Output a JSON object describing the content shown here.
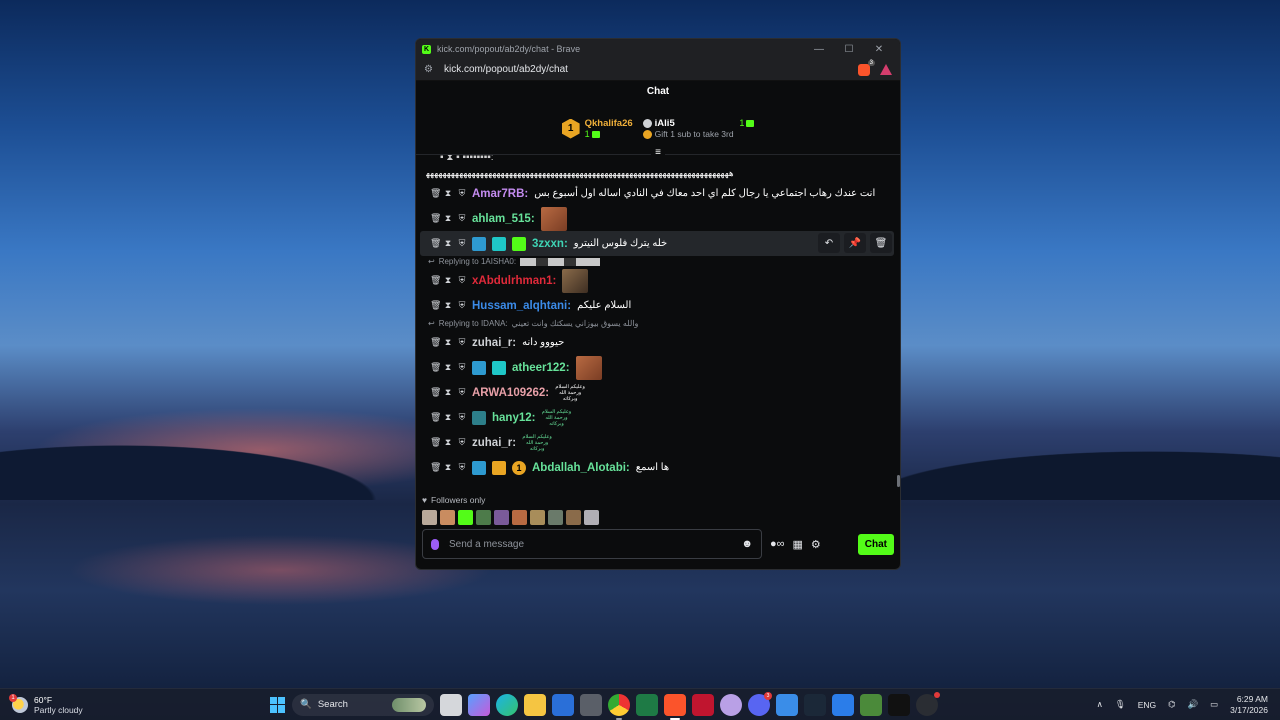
{
  "browser": {
    "title": "kick.com/popout/ab2dy/chat - Brave",
    "url": "kick.com/popout/ab2dy/chat",
    "shield_count": "3"
  },
  "chat": {
    "header": "Chat",
    "leaderboard": {
      "first": {
        "rank": "1",
        "name": "Qkhalifa26",
        "count": "1"
      },
      "second": {
        "name": "iAli5",
        "count": "1",
        "hint": "Gift 1 sub to take 3rd"
      }
    },
    "long_line": "ﻫﻬﻬﻬﻬﻬﻬﻬﻬﻬﻬﻬﻬﻬﻬﻬﻬﻬﻬﻬﻬﻬﻬﻬﻬﻬﻬﻬﻬﻬﻬﻬﻬﻬﻬﻬﻬﻬﻬﻬﻬﻬﻬﻬﻬﻬﻬﻬﻬﻬﻬﻬﻬﻬﻬﻬﻬﻬﻬﻬﻬﻬﻬﻬﻬﻬﻬﻬﻬﻬﻬﻬﻬﻬ",
    "messages": [
      {
        "user": "Amar7RB:",
        "color": "#c48cf0",
        "text": "انت عندك رهاب اجتماعي يا رجال كلم اي احد معاك في النادي اساله اول أسبوع بس"
      },
      {
        "user": "ahlam_515:",
        "color": "#67e29a",
        "text": ""
      },
      {
        "user": "3zxxn:",
        "color": "#3fd4b5",
        "text": "خله يترك فلوس النيترو"
      },
      {
        "reply": "Replying to 1AISHA0:"
      },
      {
        "user": "xAbdulrhman1:",
        "color": "#e02a3a",
        "text": ""
      },
      {
        "user": "Hussam_alqhtani:",
        "color": "#3b8be8",
        "text": "السلام عليكم"
      },
      {
        "reply": "Replying to IDANA:",
        "reply_text": "والله يسوق بيوزاني يسكتك وانت تعيني"
      },
      {
        "user": "zuhai_r:",
        "color": "#cfd2d6",
        "text": "حيووو دانه"
      },
      {
        "user": "atheer122:",
        "color": "#67e29a",
        "text": ""
      },
      {
        "user": "ARWA109262:",
        "color": "#e8a0a8",
        "text": "",
        "tiny": "وعليكم السلام ورحمة الله وبركاته"
      },
      {
        "user": "hany12:",
        "color": "#67e29a",
        "text": "",
        "tiny": "وعليكم السلام ورحمة الله وبركاته"
      },
      {
        "user": "zuhai_r:",
        "color": "#cfd2d6",
        "text": "",
        "tiny": "وعليكم السلام ورحمة الله وبركاته"
      },
      {
        "user": "Abdallah_Alotabi:",
        "color": "#67e29a",
        "text": "ها اسمع"
      }
    ],
    "followers_label": "Followers only",
    "input_placeholder": "Send a message",
    "send_label": "Chat"
  },
  "taskbar": {
    "weather_temp": "60°F",
    "weather_desc": "Partly cloudy",
    "search_label": "Search",
    "lang": "ENG",
    "time": "6:29 AM",
    "date": "3/17/2026",
    "weather_badge": "1",
    "discord_badge": "3"
  }
}
